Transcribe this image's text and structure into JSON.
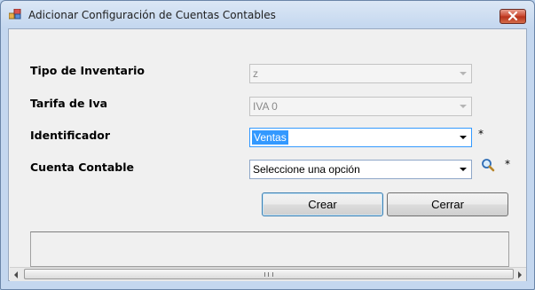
{
  "window": {
    "title": "Adicionar Configuración de Cuentas Contables"
  },
  "form": {
    "fields": [
      {
        "label": "Tipo de Inventario",
        "value": "z",
        "enabled": false,
        "required": false
      },
      {
        "label": "Tarifa de Iva",
        "value": "IVA 0",
        "enabled": false,
        "required": false
      },
      {
        "label": "Identificador",
        "value": "Ventas",
        "enabled": true,
        "required": true,
        "required_mark": "*"
      },
      {
        "label": "Cuenta Contable",
        "value": "Seleccione una opción",
        "enabled": true,
        "required": true,
        "required_mark": "*"
      }
    ],
    "buttons": {
      "create_label": "Crear",
      "close_label": "Cerrar"
    },
    "search_icon": "magnifier-icon"
  },
  "colors": {
    "title_bar": "#c4d7ef",
    "client_bg": "#f0f0f0",
    "selection": "#3399ff",
    "close_button": "#c8432b"
  }
}
